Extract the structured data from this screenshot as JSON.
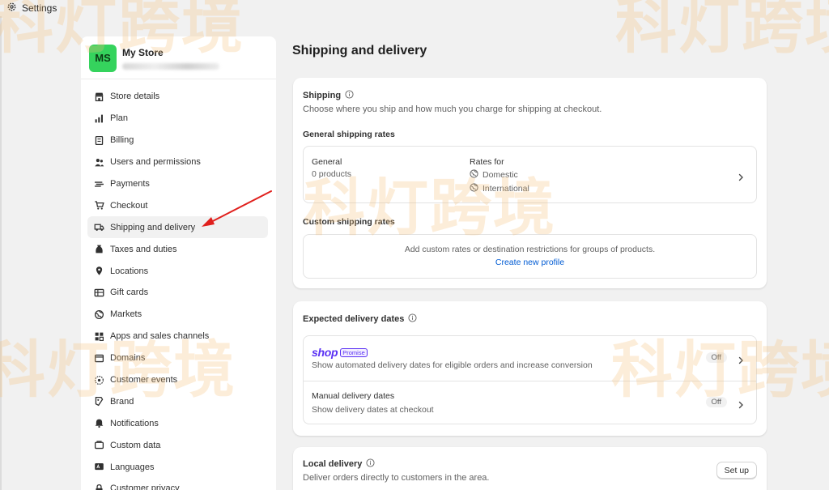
{
  "topbar": {
    "title": "Settings"
  },
  "store": {
    "initials": "MS",
    "name": "My Store"
  },
  "nav": [
    {
      "label": "Store details",
      "icon": "store-icon"
    },
    {
      "label": "Plan",
      "icon": "chart-icon"
    },
    {
      "label": "Billing",
      "icon": "receipt-icon"
    },
    {
      "label": "Users and permissions",
      "icon": "users-icon"
    },
    {
      "label": "Payments",
      "icon": "payments-icon"
    },
    {
      "label": "Checkout",
      "icon": "cart-icon"
    },
    {
      "label": "Shipping and delivery",
      "icon": "truck-icon",
      "active": true
    },
    {
      "label": "Taxes and duties",
      "icon": "tax-icon"
    },
    {
      "label": "Locations",
      "icon": "location-icon"
    },
    {
      "label": "Gift cards",
      "icon": "gift-card-icon"
    },
    {
      "label": "Markets",
      "icon": "globe-icon"
    },
    {
      "label": "Apps and sales channels",
      "icon": "apps-icon"
    },
    {
      "label": "Domains",
      "icon": "domain-icon"
    },
    {
      "label": "Customer events",
      "icon": "events-icon"
    },
    {
      "label": "Brand",
      "icon": "brand-icon"
    },
    {
      "label": "Notifications",
      "icon": "bell-icon"
    },
    {
      "label": "Custom data",
      "icon": "data-icon"
    },
    {
      "label": "Languages",
      "icon": "language-icon"
    },
    {
      "label": "Customer privacy",
      "icon": "lock-icon"
    }
  ],
  "page": {
    "title": "Shipping and delivery"
  },
  "shipping": {
    "title": "Shipping",
    "description": "Choose where you ship and how much you charge for shipping at checkout.",
    "general_rates_title": "General shipping rates",
    "general": {
      "label": "General",
      "products": "0 products",
      "rates_for": "Rates for",
      "regions": [
        "Domestic",
        "International"
      ]
    },
    "custom_rates_title": "Custom shipping rates",
    "custom": {
      "message": "Add custom rates or destination restrictions for groups of products.",
      "link": "Create new profile"
    }
  },
  "delivery_dates": {
    "title": "Expected delivery dates",
    "shop_promise": {
      "word": "shop",
      "tag": "Promise",
      "description": "Show automated delivery dates for eligible orders and increase conversion",
      "status": "Off"
    },
    "manual": {
      "label": "Manual delivery dates",
      "description": "Show delivery dates at checkout",
      "status": "Off"
    }
  },
  "local_delivery": {
    "title": "Local delivery",
    "description": "Deliver orders directly to customers in the area.",
    "button": "Set up"
  },
  "watermark": "科灯跨境",
  "colors": {
    "avatar": "#35d35d",
    "link": "#005bd3",
    "shop_brand": "#5a31f4",
    "arrow": "#e0201d"
  }
}
